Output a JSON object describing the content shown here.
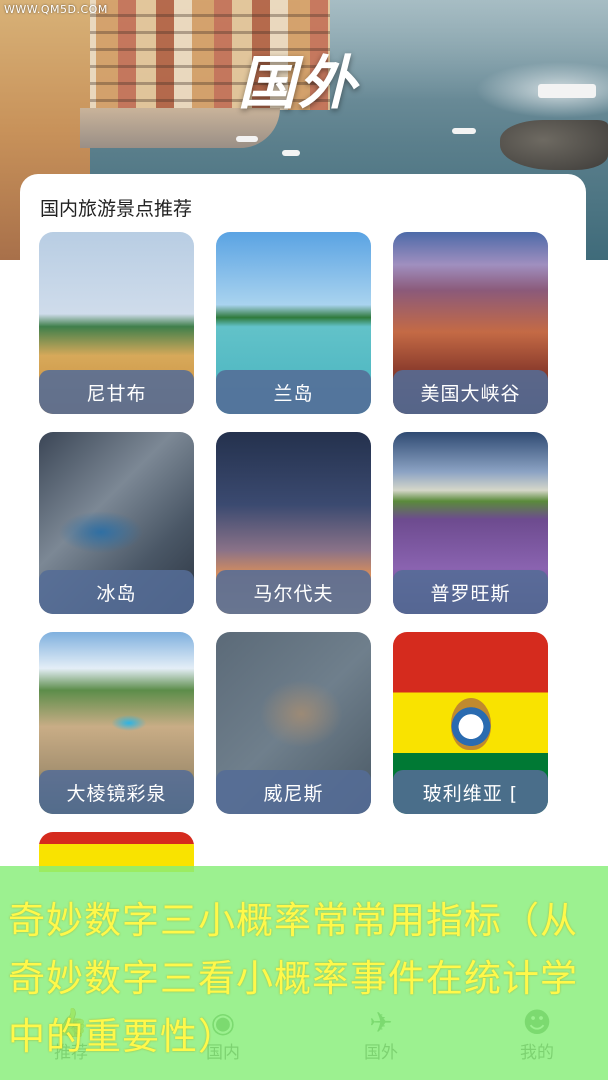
{
  "watermark": "WWW.QM5D.COM",
  "hero": {
    "title": "国外"
  },
  "section": {
    "title": "国内旅游景点推荐"
  },
  "destinations": [
    {
      "label": "尼甘布"
    },
    {
      "label": "兰岛"
    },
    {
      "label": "美国大峡谷"
    },
    {
      "label": "冰岛"
    },
    {
      "label": "马尔代夫"
    },
    {
      "label": "普罗旺斯"
    },
    {
      "label": "大棱镜彩泉"
    },
    {
      "label": "威尼斯"
    },
    {
      "label": "玻利维亚 ["
    }
  ],
  "bottom_nav": {
    "items": [
      {
        "label": "推荐",
        "icon": "thumbs-up-icon"
      },
      {
        "label": "国内",
        "icon": "location-pin-icon"
      },
      {
        "label": "国外",
        "icon": "plane-icon"
      },
      {
        "label": "我的",
        "icon": "person-icon"
      }
    ]
  },
  "overlay": {
    "text": "奇妙数字三小概率常常用指标（从奇妙数字三看小概率事件在统计学中的重要性）"
  }
}
